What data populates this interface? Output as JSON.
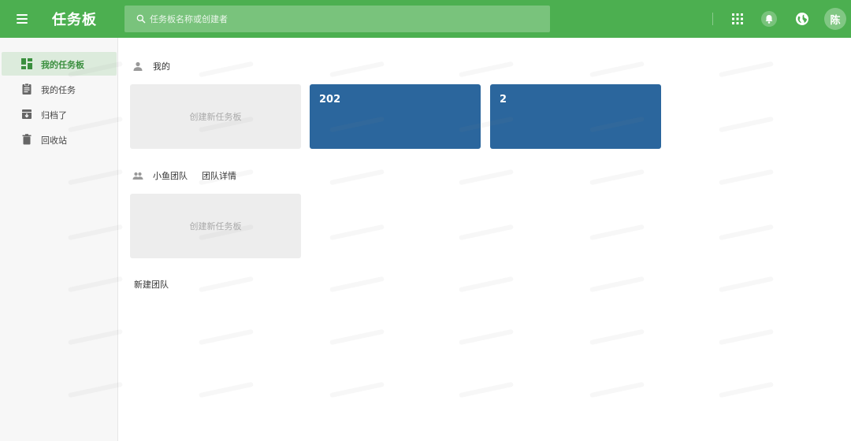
{
  "header": {
    "app_title": "任务板",
    "search_placeholder": "任务板名称或创建者",
    "avatar_text": "陈"
  },
  "sidebar": {
    "items": [
      {
        "label": "我的任务板",
        "icon": "dashboard-icon",
        "active": true
      },
      {
        "label": "我的任务",
        "icon": "clipboard-icon",
        "active": false
      },
      {
        "label": "归档了",
        "icon": "archive-icon",
        "active": false
      },
      {
        "label": "回收站",
        "icon": "trash-icon",
        "active": false
      }
    ]
  },
  "personal": {
    "title": "我的",
    "create_label": "创建新任务板",
    "boards": [
      {
        "name": "202"
      },
      {
        "name": "2"
      }
    ]
  },
  "team": {
    "title": "小鱼团队",
    "details_label": "团队详情",
    "create_label": "创建新任务板"
  },
  "new_team_label": "新建团队",
  "colors": {
    "primary": "#4caf50",
    "board": "#2b669d",
    "sidebar_active": "#dcebdc"
  }
}
